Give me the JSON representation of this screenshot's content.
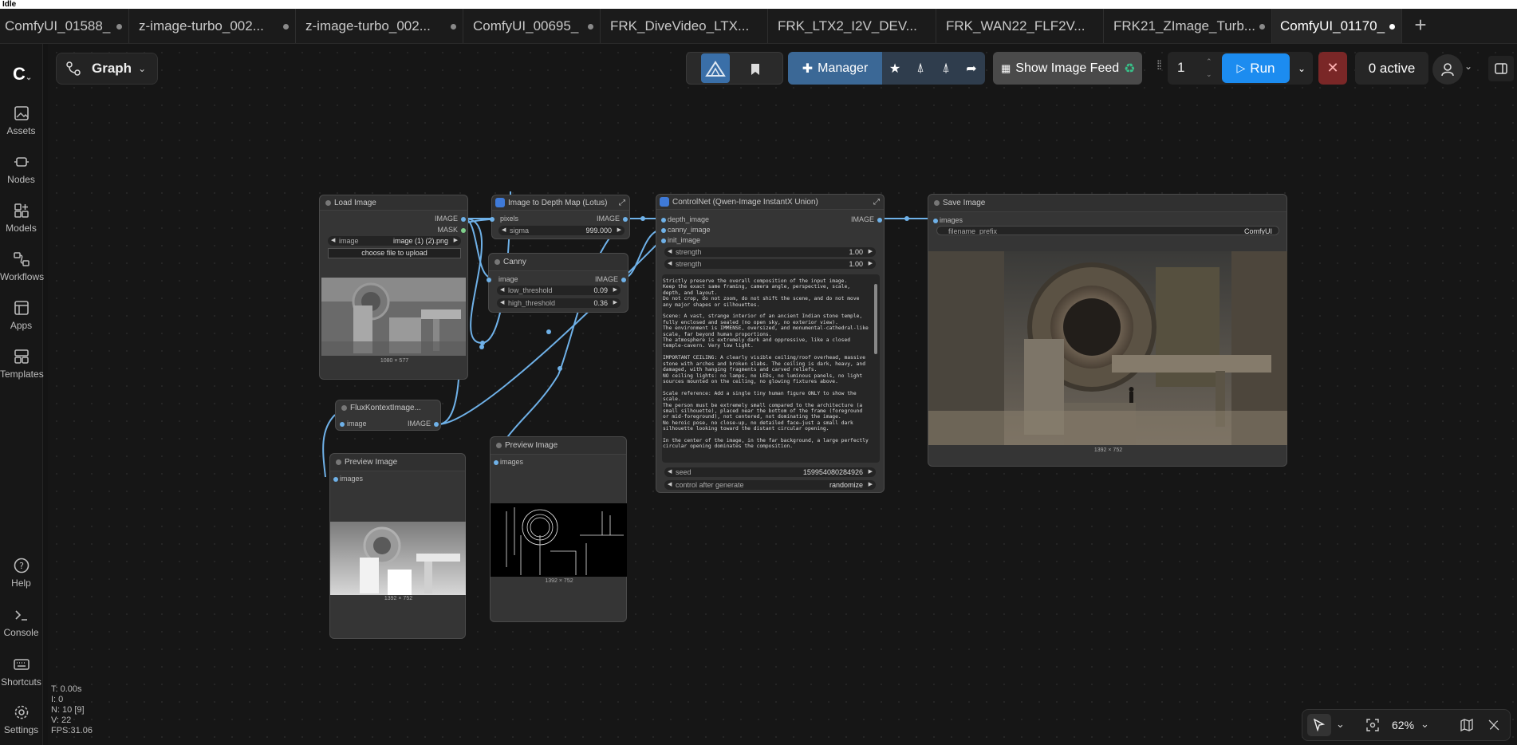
{
  "status": "Idle",
  "tabs": [
    {
      "label": "ComfyUI_01588_"
    },
    {
      "label": "z-image-turbo_002..."
    },
    {
      "label": "z-image-turbo_002..."
    },
    {
      "label": "ComfyUI_00695_"
    },
    {
      "label": "FRK_DiveVideo_LTX..."
    },
    {
      "label": "FRK_LTX2_I2V_DEV..."
    },
    {
      "label": "FRK_WAN22_FLF2V..."
    },
    {
      "label": "FRK21_ZImage_Turb..."
    },
    {
      "label": "ComfyUI_01170_"
    }
  ],
  "sidebar": {
    "items": [
      {
        "label": "Assets",
        "icon": "image-icon"
      },
      {
        "label": "Nodes",
        "icon": "nodes-icon"
      },
      {
        "label": "Models",
        "icon": "models-icon"
      },
      {
        "label": "Workflows",
        "icon": "workflows-icon"
      },
      {
        "label": "Apps",
        "icon": "apps-icon"
      },
      {
        "label": "Templates",
        "icon": "templates-icon"
      },
      {
        "label": "Help",
        "icon": "help-icon"
      },
      {
        "label": "Console",
        "icon": "console-icon"
      },
      {
        "label": "Shortcuts",
        "icon": "keyboard-icon"
      },
      {
        "label": "Settings",
        "icon": "gear-icon"
      }
    ]
  },
  "graph_button": {
    "label": "Graph"
  },
  "toolbar": {
    "manager_label": "Manager",
    "image_feed_label": "Show Image Feed",
    "queue_count": "1",
    "run_label": "Run",
    "active_label": "0 active"
  },
  "nodes": {
    "load_image": {
      "title": "Load Image",
      "out_image": "IMAGE",
      "out_mask": "MASK",
      "image_label": "image",
      "image_value": "image (1) (2).png",
      "upload_label": "choose file to upload",
      "dims": "1080 × 577"
    },
    "depth": {
      "title": "Image to Depth Map (Lotus)",
      "in_pixels": "pixels",
      "out_image": "IMAGE",
      "sigma_label": "sigma",
      "sigma_value": "999.000"
    },
    "canny": {
      "title": "Canny",
      "in_image": "image",
      "out_image": "IMAGE",
      "low_label": "low_threshold",
      "low_value": "0.09",
      "high_label": "high_threshold",
      "high_value": "0.36"
    },
    "flux": {
      "title": "FluxKontextImage...",
      "in_image": "image",
      "out_image": "IMAGE"
    },
    "controlnet": {
      "title": "ControlNet (Qwen-Image InstantX Union)",
      "in_depth": "depth_image",
      "in_canny": "canny_image",
      "in_init": "init_image",
      "out_image": "IMAGE",
      "strength1_label": "strength",
      "strength1_value": "1.00",
      "strength2_label": "strength",
      "strength2_value": "1.00",
      "prompt": "Strictly preserve the overall composition of the input image.\nKeep the exact same framing, camera angle, perspective, scale, depth, and layout.\nDo not crop, do not zoom, do not shift the scene, and do not move any major shapes or silhouettes.\n\nScene: A vast, strange interior of an ancient Indian stone temple, fully enclosed and sealed (no open sky, no exterior view).\nThe environment is IMMENSE, oversized, and monumental-cathedral-like scale, far beyond human proportions.\nThe atmosphere is extremely dark and oppressive, like a closed temple-cavern. Very low light.\n\nIMPORTANT CEILING: A clearly visible ceiling/roof overhead, massive stone with arches and broken slabs. The ceiling is dark, heavy, and damaged, with hanging fragments and carved reliefs.\nNO ceiling lights: no lamps, no LEDs, no luminous panels, no light sources mounted on the ceiling, no glowing fixtures above.\n\nScale reference: Add a single tiny human figure ONLY to show the scale.\nThe person must be extremely small compared to the architecture (a small silhouette), placed near the bottom of the frame (foreground or mid-foreground), not centered, not dominating the image.\nNo heroic pose, no close-up, no detailed face—just a small dark silhouette looking toward the distant circular opening.\n\nIn the center of the image, in the far background, a large perfectly circular opening dominates the composition.",
      "seed_label": "seed",
      "seed_value": "159954080284926",
      "control_label": "control after generate",
      "control_value": "randomize"
    },
    "save_image": {
      "title": "Save Image",
      "in_images": "images",
      "prefix_label": "filename_prefix",
      "prefix_value": "ComfyUI",
      "dims": "1392 × 752"
    },
    "preview1": {
      "title": "Preview Image",
      "in_images": "images",
      "dims": "1392 × 752"
    },
    "preview2": {
      "title": "Preview Image",
      "in_images": "images",
      "dims": "1392 × 752"
    }
  },
  "stats": {
    "t": "T: 0.00s",
    "i": "I: 0",
    "n": "N: 10 [9]",
    "v": "V: 22",
    "fps": "FPS:31.06"
  },
  "bottom": {
    "zoom": "62%"
  },
  "colors": {
    "accent": "#1c8cf0",
    "link": "#6fb1e8",
    "stop": "#7a2727",
    "background": "#161616"
  }
}
